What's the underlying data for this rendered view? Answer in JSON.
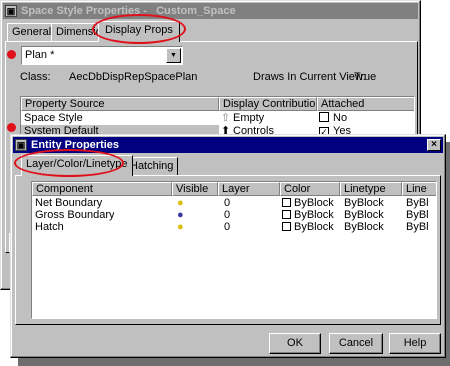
{
  "back_window": {
    "title": "Space Style Properties - _Custom_Space",
    "tabs": [
      "General",
      "Dimensions",
      "Display Props"
    ],
    "combo_value": "Plan *",
    "class_label": "Class:",
    "class_value": "AecDbDispRepSpacePlan",
    "draws_label": "Draws In Current View:",
    "draws_value": "True",
    "columns": [
      "Property Source",
      "Display Contribution",
      "Attached"
    ],
    "rows": [
      {
        "source": "Space Style",
        "contribution": "Empty",
        "attached": "No",
        "checked": false,
        "contribution_icon": "empty-arrow-icon"
      },
      {
        "source": "System Default",
        "contribution": "Controls",
        "attached": "Yes",
        "checked": true,
        "contribution_icon": "controls-arrow-icon"
      }
    ]
  },
  "front_window": {
    "title": "Entity Properties",
    "tabs": [
      "Layer/Color/Linetype",
      "Hatching"
    ],
    "columns": [
      "Component",
      "Visible",
      "Layer",
      "Color",
      "Linetype",
      "Line"
    ],
    "rows": [
      {
        "component": "Net Boundary",
        "layer": "0",
        "color": "ByBlock",
        "linetype": "ByBlock",
        "lineweight": "ByBl",
        "visible_icon": "lightbulb-on-icon"
      },
      {
        "component": "Gross Boundary",
        "layer": "0",
        "color": "ByBlock",
        "linetype": "ByBlock",
        "lineweight": "ByBl",
        "visible_icon": "lightbulb-off-icon"
      },
      {
        "component": "Hatch",
        "layer": "0",
        "color": "ByBlock",
        "linetype": "ByBlock",
        "lineweight": "ByBl",
        "visible_icon": "lightbulb-on-icon"
      }
    ],
    "ok_label": "OK",
    "cancel_label": "Cancel",
    "help_label": "Help"
  },
  "annotation_color": "#e0101a"
}
